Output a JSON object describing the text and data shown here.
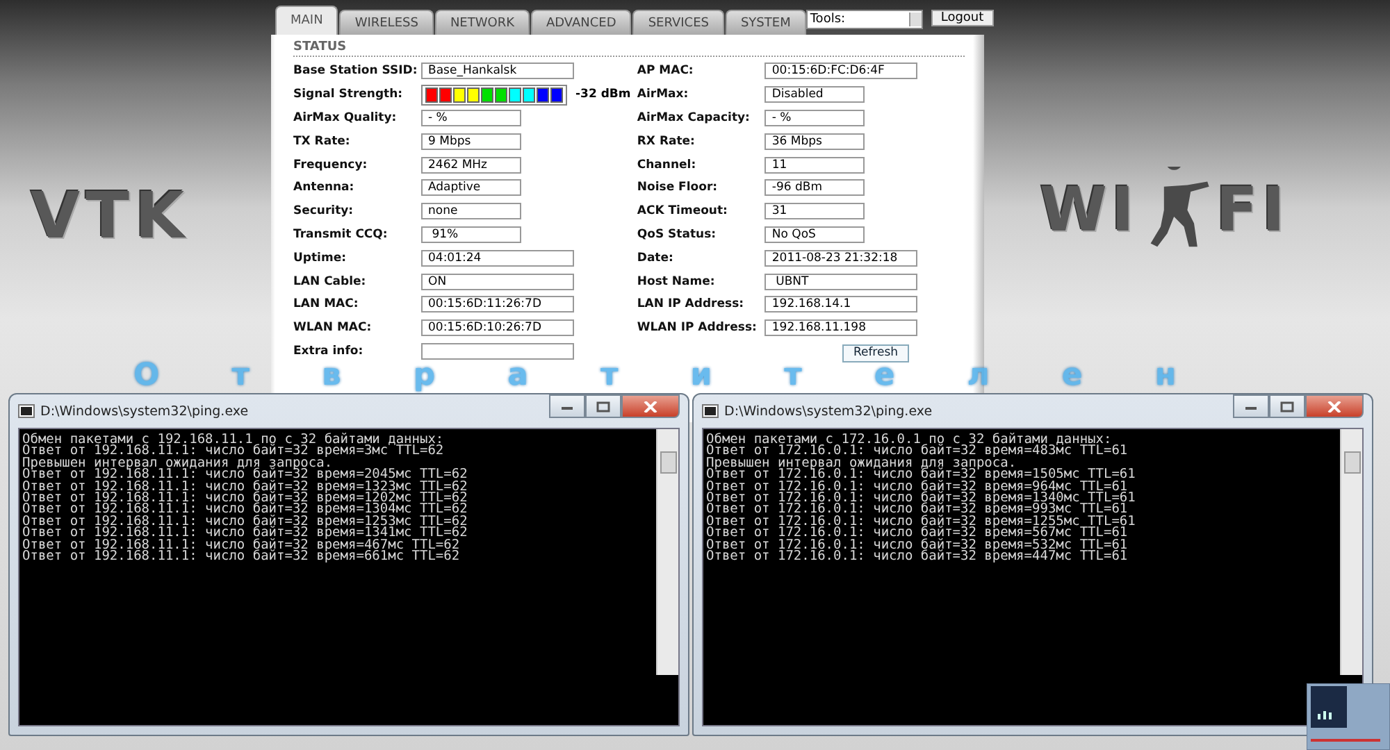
{
  "desktop_logos": {
    "left": "VTK",
    "right_start": "WI",
    "right_end": "FI"
  },
  "router": {
    "tabs": [
      {
        "label": "MAIN",
        "selected": true
      },
      {
        "label": "WIRELESS",
        "selected": false
      },
      {
        "label": "NETWORK",
        "selected": false
      },
      {
        "label": "ADVANCED",
        "selected": false
      },
      {
        "label": "SERVICES",
        "selected": false
      },
      {
        "label": "SYSTEM",
        "selected": false
      }
    ],
    "tools_select": {
      "value": "Tools:"
    },
    "logout": "Logout",
    "section_title": "STATUS",
    "fields_left": [
      {
        "kind": "field",
        "label": "Base Station SSID:",
        "value": "Base_Hankalsk",
        "wide": true
      },
      {
        "kind": "meter",
        "label": "Signal Strength:",
        "reading": "-32 dBm"
      },
      {
        "kind": "field",
        "label": "AirMax Quality:",
        "value": "- %",
        "wide": false
      },
      {
        "kind": "field",
        "label": "TX Rate:",
        "value": "9 Mbps",
        "wide": false
      },
      {
        "kind": "field",
        "label": "Frequency:",
        "value": "2462 MHz",
        "wide": false
      },
      {
        "kind": "field",
        "label": "Antenna:",
        "value": "Adaptive",
        "wide": false
      },
      {
        "kind": "field",
        "label": "Security:",
        "value": "none",
        "wide": false
      },
      {
        "kind": "field",
        "label": "Transmit CCQ:",
        "value": " 91%",
        "wide": false
      },
      {
        "kind": "field",
        "label": "Uptime:",
        "value": "04:01:24",
        "wide": true
      },
      {
        "kind": "field",
        "label": "LAN Cable:",
        "value": "ON",
        "wide": true
      },
      {
        "kind": "field",
        "label": "LAN MAC:",
        "value": "00:15:6D:11:26:7D",
        "wide": true
      },
      {
        "kind": "field",
        "label": "WLAN MAC:",
        "value": "00:15:6D:10:26:7D",
        "wide": true
      },
      {
        "kind": "select",
        "label": "Extra info:"
      }
    ],
    "fields_right": [
      {
        "label": "AP MAC:",
        "value": "00:15:6D:FC:D6:4F",
        "wide": true
      },
      {
        "label": "AirMax:",
        "value": "Disabled",
        "wide": false
      },
      {
        "label": "AirMax Capacity:",
        "value": "- %",
        "wide": false
      },
      {
        "label": "RX Rate:",
        "value": "36 Mbps",
        "wide": false
      },
      {
        "label": "Channel:",
        "value": "11",
        "wide": false
      },
      {
        "label": "Noise Floor:",
        "value": "-96 dBm",
        "wide": false
      },
      {
        "label": "ACK Timeout:",
        "value": "31",
        "wide": false
      },
      {
        "label": "QoS Status:",
        "value": "No QoS",
        "wide": false
      },
      {
        "label": "Date:",
        "value": "2011-08-23 21:32:18",
        "wide": true
      },
      {
        "label": "Host Name:",
        "value": " UBNT",
        "wide": true
      },
      {
        "label": "LAN IP Address:",
        "value": "192.168.14.1",
        "wide": true
      },
      {
        "label": "WLAN IP Address:",
        "value": "192.168.11.198",
        "wide": true
      }
    ],
    "refresh": "Refresh"
  },
  "overlay_caption": "Отвратителен",
  "consoles": [
    {
      "title": "D:\\Windows\\system32\\ping.exe",
      "lines": [
        "Обмен пакетами с 192.168.11.1 по с 32 байтами данных:",
        "Ответ от 192.168.11.1: число байт=32 время=3мс TTL=62",
        "Превышен интервал ожидания для запроса.",
        "Ответ от 192.168.11.1: число байт=32 время=2045мс TTL=62",
        "Ответ от 192.168.11.1: число байт=32 время=1323мс TTL=62",
        "Ответ от 192.168.11.1: число байт=32 время=1202мс TTL=62",
        "Ответ от 192.168.11.1: число байт=32 время=1304мс TTL=62",
        "Ответ от 192.168.11.1: число байт=32 время=1253мс TTL=62",
        "Ответ от 192.168.11.1: число байт=32 время=1341мс TTL=62",
        "Ответ от 192.168.11.1: число байт=32 время=467мс TTL=62",
        "Ответ от 192.168.11.1: число байт=32 время=661мс TTL=62"
      ]
    },
    {
      "title": "D:\\Windows\\system32\\ping.exe",
      "lines": [
        "Обмен пакетами с 172.16.0.1 по с 32 байтами данных:",
        "Ответ от 172.16.0.1: число байт=32 время=483мс TTL=61",
        "Превышен интервал ожидания для запроса.",
        "Ответ от 172.16.0.1: число байт=32 время=1505мс TTL=61",
        "Ответ от 172.16.0.1: число байт=32 время=964мс TTL=61",
        "Ответ от 172.16.0.1: число байт=32 время=1340мс TTL=61",
        "Ответ от 172.16.0.1: число байт=32 время=993мс TTL=61",
        "Ответ от 172.16.0.1: число байт=32 время=1255мс TTL=61",
        "Ответ от 172.16.0.1: число байт=32 время=567мс TTL=61",
        "Ответ от 172.16.0.1: число байт=32 время=532мс TTL=61",
        "Ответ от 172.16.0.1: число байт=32 время=447мс TTL=61"
      ]
    }
  ]
}
